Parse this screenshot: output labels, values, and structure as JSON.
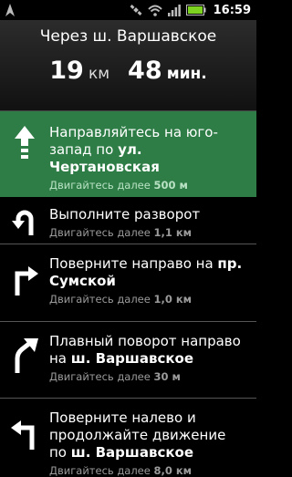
{
  "status_bar": {
    "time": "16:59",
    "icons": [
      "navigation-arrow-icon",
      "gps-satellite-icon",
      "wifi-icon",
      "signal-bars-icon",
      "battery-icon"
    ]
  },
  "route": {
    "title": "Через ш. Варшавское",
    "distance_value": "19",
    "distance_unit": "км",
    "time_value": "48",
    "time_unit": "мин."
  },
  "steps": [
    {
      "icon": "straight-arrow-icon",
      "text_prefix": "Направляйтесь на юго-запад по ",
      "text_bold": "ул. Чертановская",
      "dist_prefix": "Двигайтесь далее ",
      "dist_value": "500 м"
    },
    {
      "icon": "u-turn-icon",
      "text_prefix": "Выполните разворот",
      "text_bold": "",
      "dist_prefix": "Двигайтесь далее ",
      "dist_value": "1,1 км"
    },
    {
      "icon": "turn-right-icon",
      "text_prefix": "Поверните направо на ",
      "text_bold": "пр. Сумской",
      "dist_prefix": "Двигайтесь далее ",
      "dist_value": "1,0 км"
    },
    {
      "icon": "slight-right-icon",
      "text_prefix": "Плавный поворот направо на ",
      "text_bold": "ш. Варшавское",
      "dist_prefix": "Двигайтесь далее ",
      "dist_value": "30 м"
    },
    {
      "icon": "turn-left-icon",
      "text_prefix": "Поверните налево и продолжайте движение по ",
      "text_bold": "ш. Варшавское",
      "dist_prefix": "Двигайтесь далее ",
      "dist_value": "8,0 км"
    }
  ]
}
